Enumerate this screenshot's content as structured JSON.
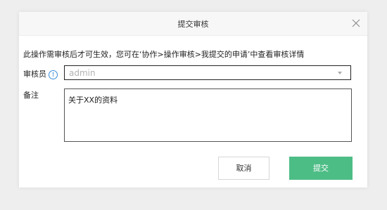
{
  "dialog": {
    "title": "提交审核",
    "close_icon": "close-icon",
    "notice": "此操作需审核后才可生效，您可在‘协作>操作审核>我提交的申请’中查看审核详情",
    "reviewer": {
      "label": "审核员",
      "info_icon": "info-icon",
      "info_glyph": "!",
      "selected_value": "admin"
    },
    "remark": {
      "label": "备注",
      "value": "关于XX的资料"
    },
    "buttons": {
      "cancel_label": "取消",
      "submit_label": "提交"
    },
    "colors": {
      "submit_bg": "#4dbd86",
      "info_icon": "#3b8cd8"
    }
  }
}
